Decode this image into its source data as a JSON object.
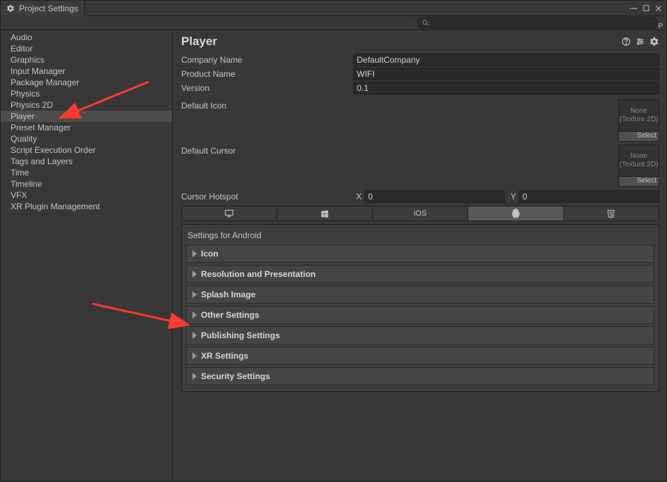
{
  "titlebar": {
    "tab_title": "Project Settings"
  },
  "search": {
    "placeholder": ""
  },
  "sidebar": {
    "items": [
      {
        "label": "Audio"
      },
      {
        "label": "Editor"
      },
      {
        "label": "Graphics"
      },
      {
        "label": "Input Manager"
      },
      {
        "label": "Package Manager"
      },
      {
        "label": "Physics"
      },
      {
        "label": "Physics 2D"
      },
      {
        "label": "Player",
        "selected": true
      },
      {
        "label": "Preset Manager"
      },
      {
        "label": "Quality"
      },
      {
        "label": "Script Execution Order"
      },
      {
        "label": "Tags and Layers"
      },
      {
        "label": "Time"
      },
      {
        "label": "Timeline"
      },
      {
        "label": "VFX"
      },
      {
        "label": "XR Plugin Management"
      }
    ]
  },
  "header": {
    "title": "Player"
  },
  "form": {
    "company_label": "Company Name",
    "company_value": "DefaultCompany",
    "product_label": "Product Name",
    "product_value": "WIFI",
    "version_label": "Version",
    "version_value": "0.1"
  },
  "default_icon": {
    "label": "Default Icon",
    "placeholder_line1": "None",
    "placeholder_line2": "(Texture 2D)",
    "select": "Select"
  },
  "default_cursor": {
    "label": "Default Cursor",
    "placeholder_line1": "None",
    "placeholder_line2": "(Texture 2D)",
    "select": "Select"
  },
  "hotspot": {
    "label": "Cursor Hotspot",
    "x_label": "X",
    "x_value": "0",
    "y_label": "Y",
    "y_value": "0"
  },
  "platform_tabs": {
    "ios_label": "iOS"
  },
  "android_panel": {
    "title": "Settings for Android",
    "folds": [
      {
        "label": "Icon"
      },
      {
        "label": "Resolution and Presentation"
      },
      {
        "label": "Splash Image"
      },
      {
        "label": "Other Settings"
      },
      {
        "label": "Publishing Settings"
      },
      {
        "label": "XR Settings"
      },
      {
        "label": "Security Settings"
      }
    ]
  },
  "right_edge_letter": "P"
}
